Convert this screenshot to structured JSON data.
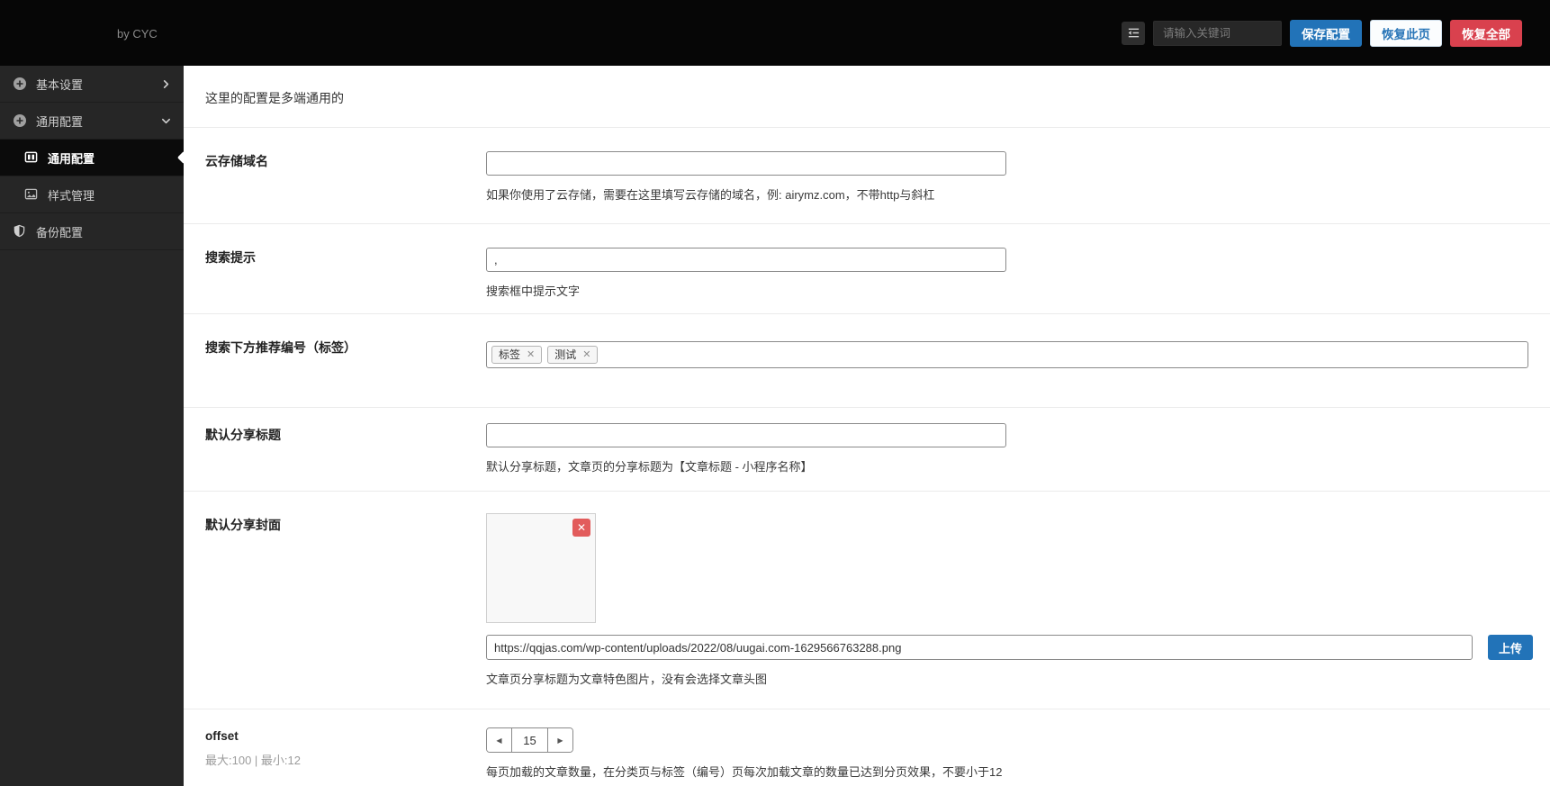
{
  "header": {
    "brand": "by CYC",
    "search": {
      "placeholder": "请输入关键词"
    },
    "save_label": "保存配置",
    "restore_page_label": "恢复此页",
    "restore_all_label": "恢复全部"
  },
  "sidebar": {
    "items": [
      {
        "label": "基本设置",
        "icon": "plus-circle",
        "level": 1,
        "chevron": "right"
      },
      {
        "label": "通用配置",
        "icon": "plus-circle",
        "level": 1,
        "chevron": "down"
      },
      {
        "label": "通用配置",
        "icon": "columns",
        "level": 2,
        "active": true
      },
      {
        "label": "样式管理",
        "icon": "image",
        "level": 2
      },
      {
        "label": "备份配置",
        "icon": "shield",
        "level": 1
      }
    ]
  },
  "content": {
    "intro": "这里的配置是多端通用的",
    "fields": {
      "cloud_domain": {
        "label": "云存储域名",
        "value": "",
        "help": "如果你使用了云存储，需要在这里填写云存储的域名，例: airymz.com，不带http与斜杠"
      },
      "search_hint": {
        "label": "搜索提示",
        "value": ",",
        "help": "搜索框中提示文字"
      },
      "search_tags": {
        "label": "搜索下方推荐编号（标签）",
        "tags": [
          "标签",
          "测试"
        ]
      },
      "share_title": {
        "label": "默认分享标题",
        "value": "",
        "help": "默认分享标题，文章页的分享标题为【文章标题 - 小程序名称】"
      },
      "share_cover": {
        "label": "默认分享封面",
        "url": "https://qqjas.com/wp-content/uploads/2022/08/uugai.com-1629566763288.png",
        "upload_label": "上传",
        "help": "文章页分享标题为文章特色图片，没有会选择文章头图"
      },
      "offset": {
        "label": "offset",
        "limits": "最大:100 | 最小:12",
        "value": "15",
        "help": "每页加载的文章数量，在分类页与标签（编号）页每次加载文章的数量已达到分页效果，不要小于12"
      }
    }
  },
  "icons": {
    "close": "✕",
    "arrow_left": "◀",
    "arrow_right": "▶"
  },
  "colors": {
    "primary_blue": "#2273b8",
    "danger_red": "#d9414e",
    "delete_red": "#e25c5c",
    "topbar_black": "#060606",
    "sidebar_dark": "#262626",
    "sidebar_active": "#0b0b0b"
  }
}
